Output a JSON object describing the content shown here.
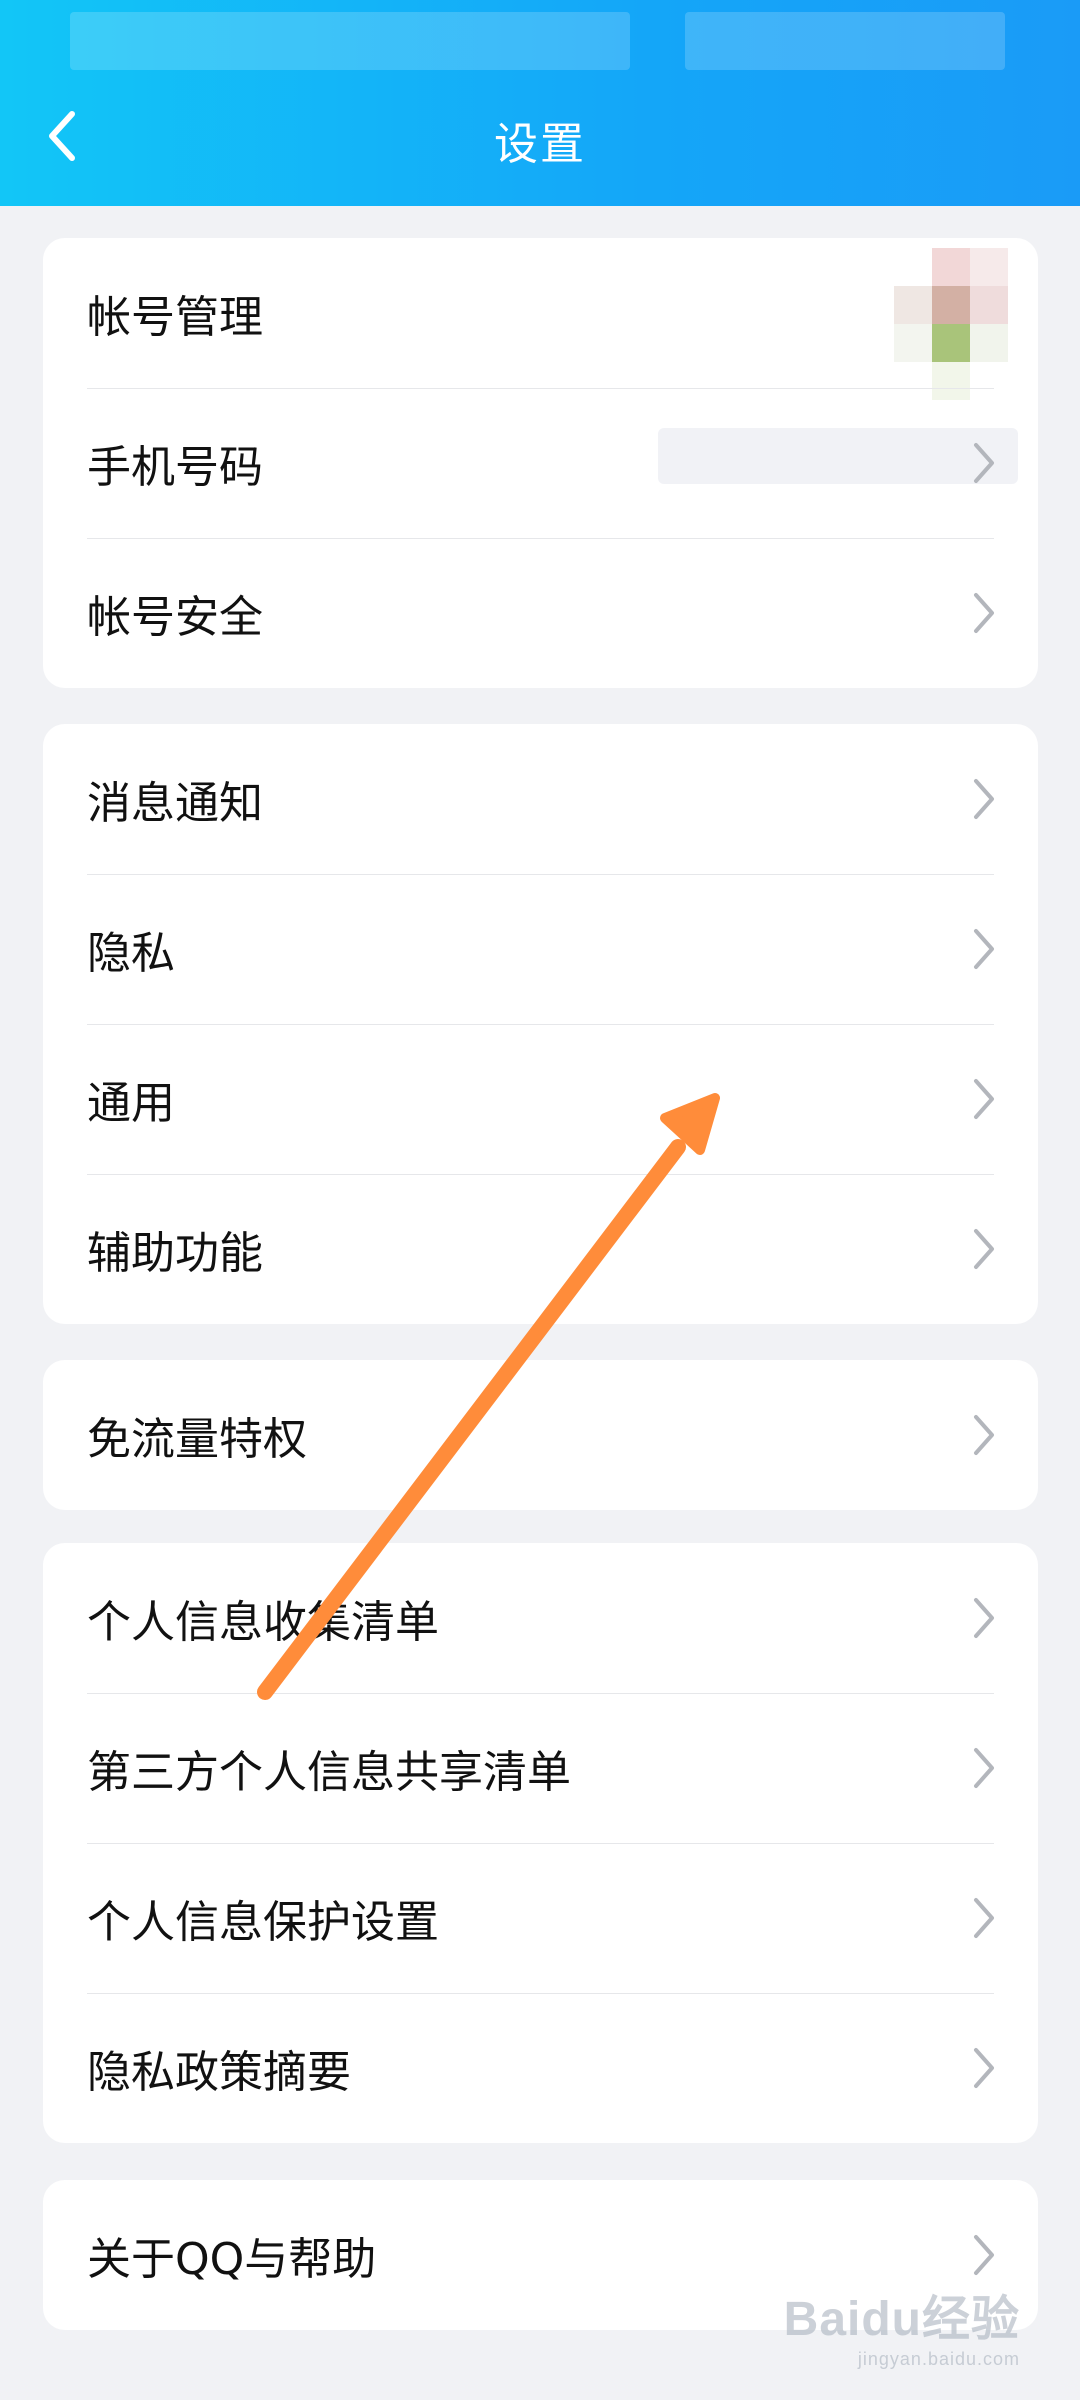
{
  "header": {
    "title": "设置",
    "back_icon": "chevron-left-icon"
  },
  "groups": [
    {
      "rows": [
        {
          "label": "帐号管理",
          "chevron": false
        },
        {
          "label": "手机号码",
          "chevron": true
        },
        {
          "label": "帐号安全",
          "chevron": true
        }
      ]
    },
    {
      "rows": [
        {
          "label": "消息通知",
          "chevron": true
        },
        {
          "label": "隐私",
          "chevron": true
        },
        {
          "label": "通用",
          "chevron": true
        },
        {
          "label": "辅助功能",
          "chevron": true
        }
      ]
    },
    {
      "rows": [
        {
          "label": "免流量特权",
          "chevron": true
        }
      ]
    },
    {
      "rows": [
        {
          "label": "个人信息收集清单",
          "chevron": true
        },
        {
          "label": "第三方个人信息共享清单",
          "chevron": true
        },
        {
          "label": "个人信息保护设置",
          "chevron": true
        },
        {
          "label": "隐私政策摘要",
          "chevron": true
        }
      ]
    },
    {
      "rows": [
        {
          "label": "关于QQ与帮助",
          "chevron": true
        }
      ]
    }
  ],
  "annotation": {
    "type": "arrow-icon",
    "color": "#ff8c3a"
  },
  "watermark": {
    "main": "Baidu经验",
    "sub": "jingyan.baidu.com"
  },
  "colors": {
    "header_start": "#12c6f7",
    "header_end": "#1a9bf7",
    "background": "#f1f2f5",
    "chevron": "#b3b6bc"
  }
}
